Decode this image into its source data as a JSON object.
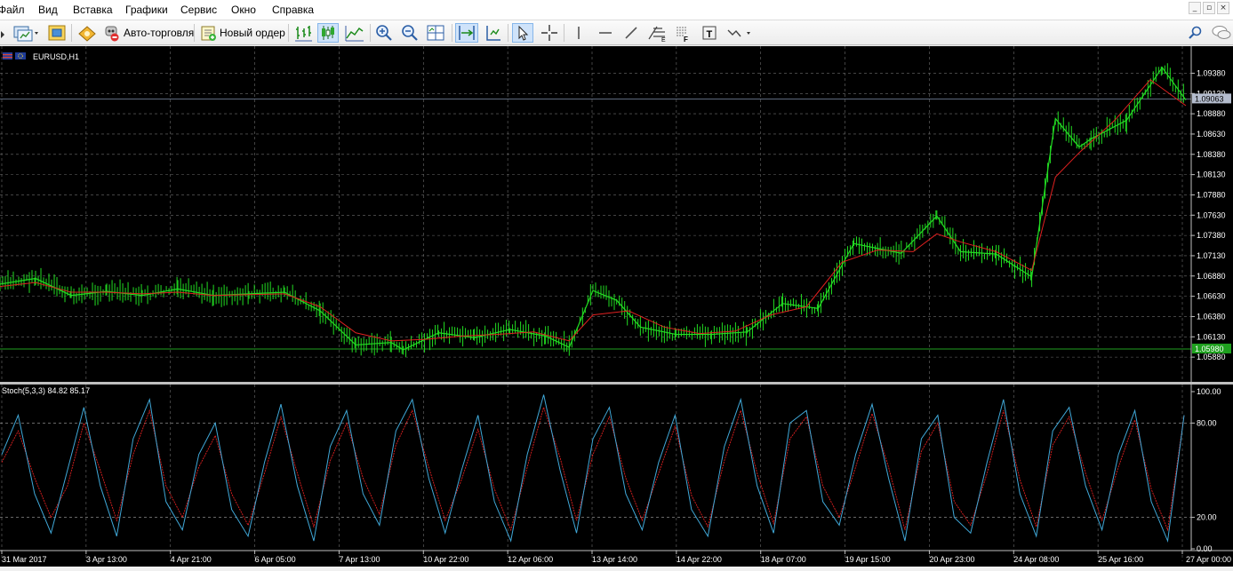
{
  "menu": {
    "items": [
      "Файл",
      "Вид",
      "Вставка",
      "Графики",
      "Сервис",
      "Окно",
      "Справка"
    ]
  },
  "toolbar": {
    "autotrade_label": "Авто-торговля",
    "neworder_label": "Новый ордер"
  },
  "window_controls": [
    "_",
    "▫",
    "×"
  ],
  "chart_data": {
    "type": "line",
    "symbol_label": "EURUSD,H1",
    "price_axis": {
      "ticks": [
        "1.09380",
        "1.09130",
        "1.08880",
        "1.08630",
        "1.08380",
        "1.08130",
        "1.07880",
        "1.07630",
        "1.07380",
        "1.07130",
        "1.06880",
        "1.06630",
        "1.06380",
        "1.06130",
        "1.05880"
      ],
      "ylim": [
        1.0575,
        1.0956
      ],
      "current_price": "1.09063",
      "marked_price": "1.05980"
    },
    "price_series": {
      "name": "EURUSD,H1",
      "color": "#22dd22",
      "x": [
        0,
        3,
        6,
        9,
        12,
        15,
        18,
        21,
        24,
        27,
        30,
        33,
        34,
        37,
        40,
        43,
        46,
        48,
        50,
        52,
        54,
        57,
        60,
        63,
        66,
        69,
        72,
        74,
        76,
        79,
        81,
        84,
        87,
        89,
        91,
        92,
        95,
        98,
        100
      ],
      "y": [
        1.0678,
        1.0685,
        1.0664,
        1.0669,
        1.0664,
        1.0672,
        1.0664,
        1.0666,
        1.0668,
        1.0645,
        1.0603,
        1.0606,
        1.0597,
        1.0618,
        1.0612,
        1.0622,
        1.0614,
        1.06,
        1.067,
        1.0658,
        1.0625,
        1.0616,
        1.0616,
        1.0619,
        1.0654,
        1.0648,
        1.0728,
        1.0722,
        1.0716,
        1.0762,
        1.0718,
        1.0715,
        1.0687,
        1.0882,
        1.0847,
        1.0857,
        1.088,
        1.0945,
        1.0905
      ]
    },
    "ma_series": {
      "color": "#e02020",
      "x": [
        0,
        3,
        6,
        9,
        12,
        15,
        18,
        21,
        24,
        27,
        30,
        33,
        36,
        39,
        42,
        45,
        48,
        50,
        53,
        56,
        59,
        62,
        65,
        68,
        71,
        74,
        77,
        79,
        81,
        84,
        87,
        89,
        91,
        94,
        97,
        100
      ],
      "y": [
        1.0675,
        1.068,
        1.0668,
        1.0668,
        1.0666,
        1.0668,
        1.0664,
        1.0665,
        1.0666,
        1.065,
        1.0618,
        1.0608,
        1.061,
        1.0614,
        1.0616,
        1.0619,
        1.0608,
        1.064,
        1.0645,
        1.0625,
        1.0617,
        1.062,
        1.064,
        1.065,
        1.0705,
        1.072,
        1.0718,
        1.074,
        1.073,
        1.0718,
        1.0695,
        1.081,
        1.084,
        1.088,
        1.093,
        1.0898
      ]
    },
    "time_labels": [
      "31 Mar 2017",
      "3 Apr 13:00",
      "4 Apr 21:00",
      "6 Apr 05:00",
      "7 Apr 13:00",
      "10 Apr 22:00",
      "12 Apr 06:00",
      "13 Apr 14:00",
      "14 Apr 22:00",
      "18 Apr 07:00",
      "19 Apr 15:00",
      "20 Apr 23:00",
      "24 Apr 08:00",
      "25 Apr 16:00",
      "27 Apr 00:00"
    ],
    "indicator": {
      "label": "Stoch(5,3,3) 84.82 85.17",
      "ticks": [
        "100.00",
        "80.00",
        "20.00",
        "0.00"
      ],
      "ylim": [
        0,
        100
      ],
      "main_color": "#40a8d8",
      "signal_color": "#e02020",
      "main": [
        60,
        85,
        35,
        10,
        50,
        90,
        40,
        8,
        70,
        95,
        30,
        12,
        60,
        80,
        25,
        8,
        55,
        92,
        40,
        5,
        65,
        88,
        35,
        15,
        75,
        95,
        45,
        10,
        50,
        85,
        30,
        5,
        60,
        98,
        50,
        10,
        70,
        90,
        35,
        12,
        55,
        85,
        25,
        8,
        65,
        95,
        40,
        10,
        80,
        88,
        30,
        15,
        60,
        92,
        45,
        5,
        70,
        85,
        20,
        10,
        55,
        95,
        35,
        8,
        75,
        90,
        40,
        12,
        60,
        88,
        30,
        5,
        85
      ],
      "signal": [
        55,
        75,
        45,
        20,
        40,
        80,
        50,
        18,
        60,
        88,
        40,
        20,
        52,
        72,
        35,
        15,
        48,
        84,
        48,
        14,
        56,
        80,
        45,
        22,
        66,
        88,
        52,
        18,
        44,
        76,
        38,
        12,
        52,
        90,
        58,
        18,
        60,
        84,
        45,
        18,
        48,
        78,
        34,
        14,
        56,
        88,
        48,
        16,
        70,
        84,
        40,
        20,
        52,
        86,
        52,
        12,
        62,
        80,
        30,
        15,
        48,
        88,
        44,
        14,
        66,
        84,
        48,
        18,
        52,
        82,
        38,
        12,
        85
      ]
    }
  }
}
